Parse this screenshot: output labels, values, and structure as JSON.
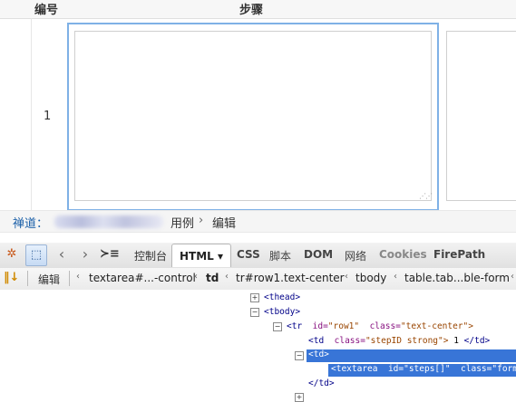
{
  "table": {
    "header_id": "编号",
    "header_steps": "步骤",
    "row_number": "1"
  },
  "breadcrumb": {
    "home": "禅道：",
    "usecase": "用例",
    "separator": "›",
    "edit": "编辑"
  },
  "firebug": {
    "tabs": {
      "console": "控制台",
      "html": "HTML ▾",
      "css": "CSS",
      "script": "脚本",
      "dom": "DOM",
      "net": "网络",
      "cookies": "Cookies",
      "firepath": "FirePath"
    },
    "edit_label": "编辑",
    "crumbs": [
      "textarea#...-control",
      "td",
      "tr#row1.text-center",
      "tbody",
      "table.tab...ble-form"
    ],
    "tree": {
      "thead": "<thead>",
      "tbody": "<tbody>",
      "tr_open": "<tr",
      "tr_id_attr": "id=",
      "tr_id_val": "\"row1\"",
      "tr_class_attr": "class=",
      "tr_class_val": "\"text-center\">",
      "td1_open": "<td",
      "td1_class_attr": "class=",
      "td1_class_val": "\"stepID strong\">",
      "td1_text": "1",
      "td1_close": "</td>",
      "td2_open": "<td>",
      "textarea_open": "<textarea",
      "textarea_id_attr": "id=",
      "textarea_id_val": "\"steps[]\"",
      "textarea_class_attr": "class=",
      "textarea_class_val": "\"form-",
      "td2_close": "</td>"
    }
  },
  "colors": {
    "focus_border": "#7fb1e6",
    "link_blue": "#1a5fa8",
    "selection": "#3875d7"
  }
}
